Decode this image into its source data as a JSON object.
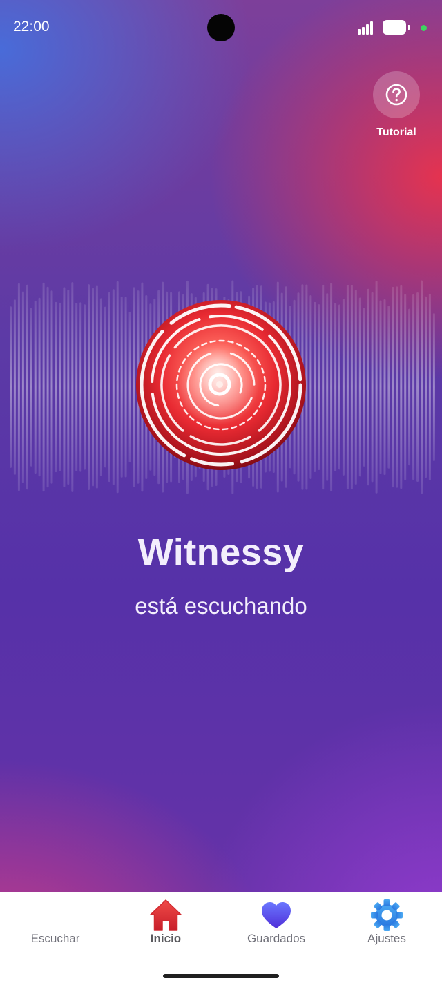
{
  "status_bar": {
    "time": "22:00",
    "icons": [
      "signal-icon",
      "battery-icon",
      "privacy-dot-icon"
    ]
  },
  "tutorial": {
    "icon": "help-circle-icon",
    "label": "Tutorial"
  },
  "hero": {
    "icon": "listening-orb-icon",
    "title": "Witnessy",
    "subtitle": "está escuchando"
  },
  "colors": {
    "accent_red": "#e8323a",
    "active_nav": "#e24a44",
    "listen_blue": "#2aa0e6",
    "heart_purple": "#5a4de6",
    "gear_blue": "#3a8ee8"
  },
  "nav": {
    "items": [
      {
        "label": "Escuchar",
        "icon": "soundwave-icon",
        "active": false
      },
      {
        "label": "Inicio",
        "icon": "home-icon",
        "active": true
      },
      {
        "label": "Guardados",
        "icon": "heart-icon",
        "active": false
      },
      {
        "label": "Ajustes",
        "icon": "gear-icon",
        "active": false
      }
    ]
  }
}
